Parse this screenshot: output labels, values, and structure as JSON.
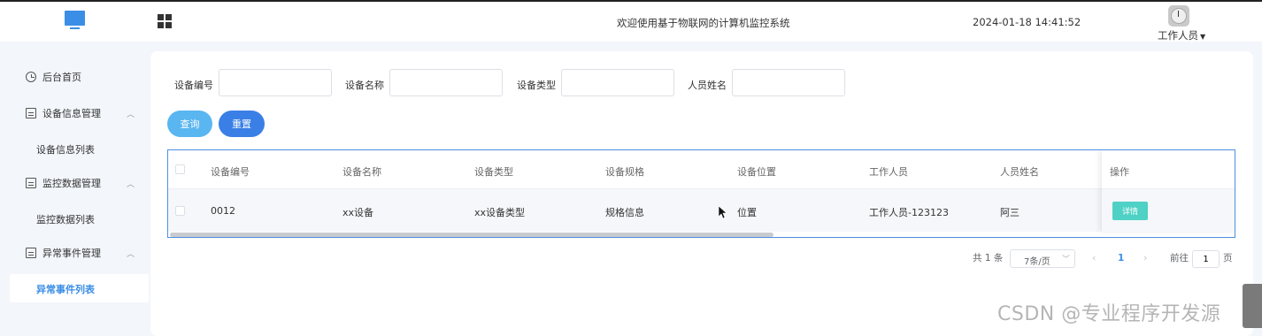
{
  "header": {
    "system_title": "欢迎使用基于物联网的计算机监控系统",
    "datetime": "2024-01-18 14:41:52",
    "user_label": "工作人员",
    "logo_icon": "monitor-icon",
    "menu_toggle_icon": "grid-icon"
  },
  "sidebar": {
    "items": [
      {
        "label": "后台首页",
        "icon": "clock-icon"
      },
      {
        "label": "设备信息管理",
        "icon": "box-icon",
        "sub": "设备信息列表"
      },
      {
        "label": "监控数据管理",
        "icon": "box-icon",
        "sub": "监控数据列表"
      },
      {
        "label": "异常事件管理",
        "icon": "box-icon",
        "sub": "异常事件列表"
      }
    ],
    "active_sub": "异常事件列表",
    "accent_color": "#3a8ee6"
  },
  "filters": {
    "device_no_label": "设备编号",
    "device_name_label": "设备名称",
    "device_type_label": "设备类型",
    "person_name_label": "人员姓名",
    "query_button": "查询",
    "reset_button": "重置"
  },
  "table": {
    "columns": [
      "设备编号",
      "设备名称",
      "设备类型",
      "设备规格",
      "设备位置",
      "工作人员",
      "人员姓名",
      "操作"
    ],
    "rows": [
      {
        "device_no": "0012",
        "device_name": "xx设备",
        "device_type": "xx设备类型",
        "spec": "规格信息",
        "location": "位置",
        "worker": "工作人员-123123",
        "person_name": "阿三",
        "action": "详情"
      }
    ]
  },
  "pagination": {
    "total": "共 1 条",
    "page_size": "7条/页",
    "current_page": "1",
    "goto_label": "前往",
    "goto_value": "1",
    "page_suffix": "页"
  },
  "watermark": "CSDN @专业程序开发源"
}
